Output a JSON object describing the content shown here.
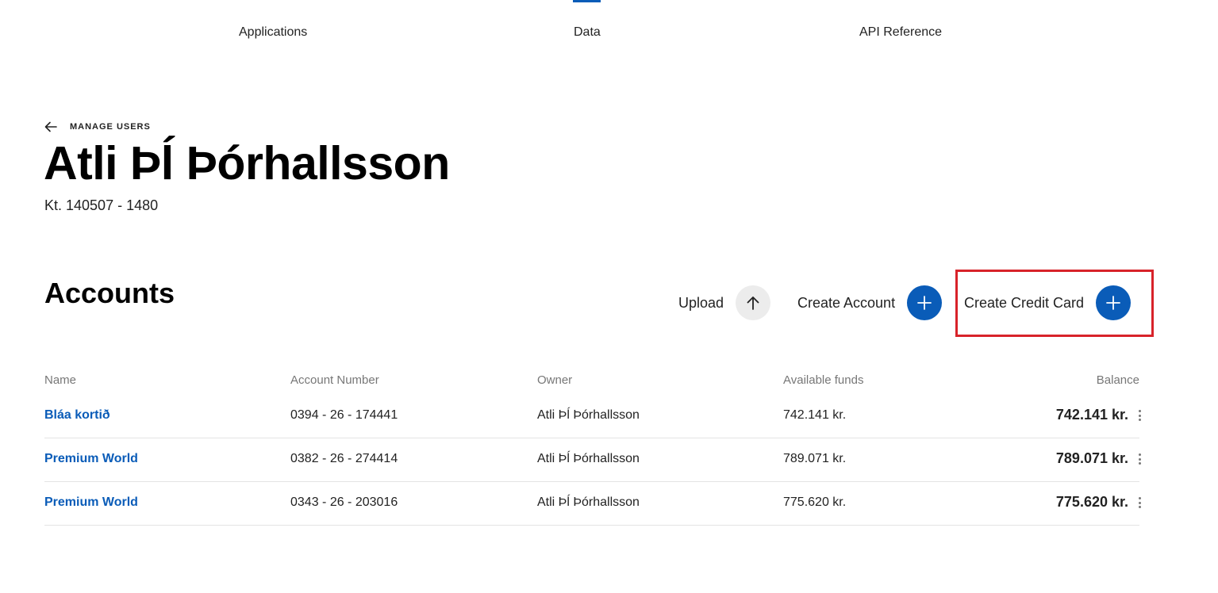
{
  "nav": {
    "items": [
      "Applications",
      "Data",
      "API Reference"
    ],
    "active": "Data",
    "accent": "#0a5cb8"
  },
  "back": {
    "label": "MANAGE USERS",
    "icon": "arrow-left-icon"
  },
  "user": {
    "name": "Atli Þĺ Þórhallsson",
    "id": "Kt. 140507 - 1480"
  },
  "section": {
    "title": "Accounts"
  },
  "actions": {
    "upload": {
      "label": "Upload",
      "icon": "arrow-up-icon"
    },
    "create_account": {
      "label": "Create Account",
      "icon": "plus-icon"
    },
    "create_credit_card": {
      "label": "Create Credit Card",
      "icon": "plus-icon"
    }
  },
  "highlight_color": "#d8232a",
  "table": {
    "columns": [
      "Name",
      "Account Number",
      "Owner",
      "Available funds",
      "Balance"
    ],
    "rows": [
      {
        "name": "Bláa kortið",
        "number": "0394 - 26 - 174441",
        "owner": "Atli Þĺ Þórhallsson",
        "available": "742.141 kr.",
        "balance": "742.141 kr."
      },
      {
        "name": "Premium World",
        "number": "0382 - 26 - 274414",
        "owner": "Atli Þĺ Þórhallsson",
        "available": "789.071 kr.",
        "balance": "789.071 kr."
      },
      {
        "name": "Premium World",
        "number": "0343 - 26 - 203016",
        "owner": "Atli Þĺ Þórhallsson",
        "available": "775.620 kr.",
        "balance": "775.620 kr."
      }
    ]
  }
}
